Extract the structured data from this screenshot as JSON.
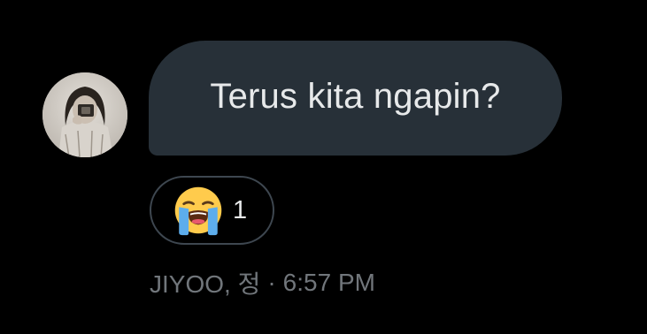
{
  "message": {
    "text": "Terus kita ngapin?",
    "bubble_color": "#273038",
    "text_color": "#e7e9ea"
  },
  "avatar": {
    "icon": "user-avatar-photo"
  },
  "reaction": {
    "emoji": "😭",
    "emoji_icon": "loudly-crying-face-icon",
    "count": "1"
  },
  "meta": {
    "sender": "JIYOO, 정",
    "separator": "·",
    "time": "6:57 PM",
    "color": "#71767b"
  }
}
